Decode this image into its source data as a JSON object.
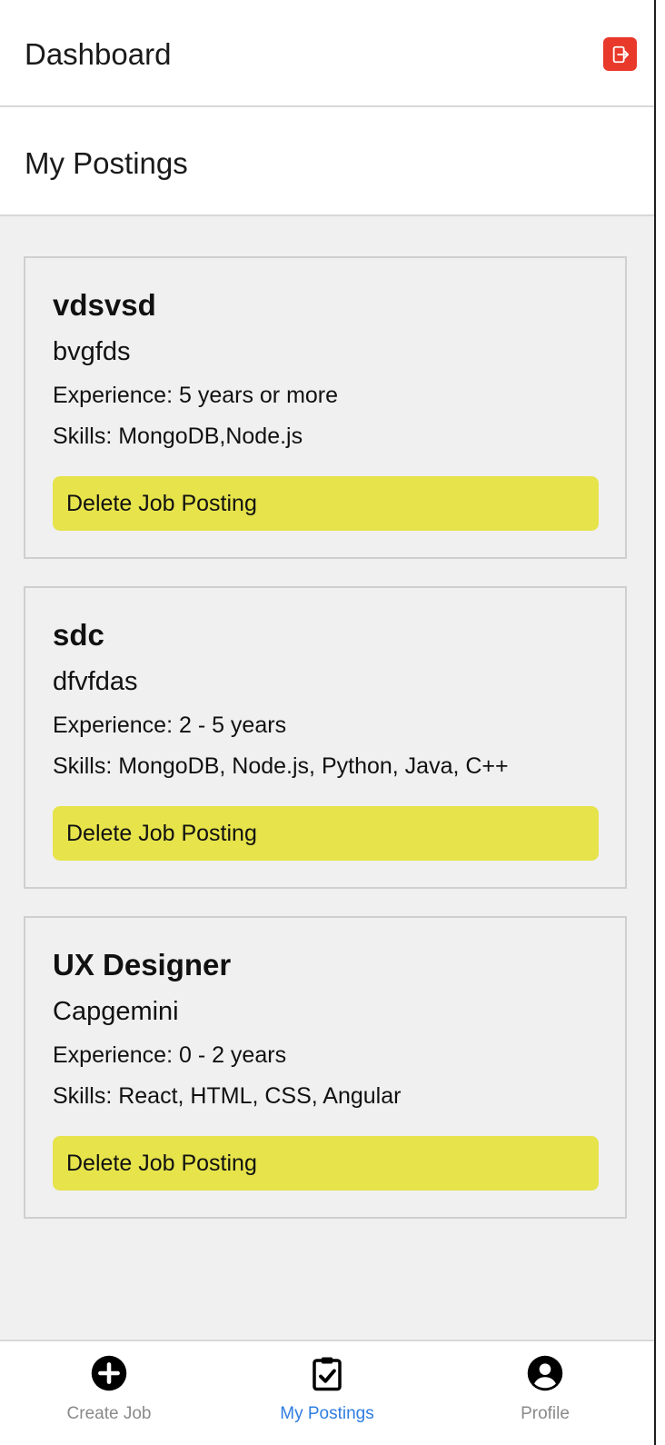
{
  "header": {
    "title": "Dashboard",
    "logout_icon": "logout-icon",
    "logout_color": "#e8392a"
  },
  "subheader": {
    "title": "My Postings"
  },
  "postings": [
    {
      "title": "vdsvsd",
      "company": "bvgfds",
      "experience": "Experience: 5 years or more",
      "skills": "Skills: MongoDB,Node.js",
      "delete_label": "Delete Job Posting"
    },
    {
      "title": "sdc",
      "company": "dfvfdas",
      "experience": "Experience: 2 - 5 years",
      "skills": "Skills: MongoDB, Node.js, Python, Java, C++",
      "delete_label": "Delete Job Posting"
    },
    {
      "title": "UX Designer",
      "company": "Capgemini",
      "experience": "Experience: 0 - 2 years",
      "skills": "Skills: React, HTML, CSS, Angular",
      "delete_label": "Delete Job Posting"
    }
  ],
  "tabs": [
    {
      "label": "Create Job",
      "icon": "plus-circle-icon",
      "active": false
    },
    {
      "label": "My Postings",
      "icon": "clipboard-check-icon",
      "active": true
    },
    {
      "label": "Profile",
      "icon": "user-circle-icon",
      "active": false
    }
  ],
  "colors": {
    "delete_button": "#e6e34b",
    "active_tab": "#2f7de1",
    "inactive_tab": "#8a8a8a",
    "background": "#f0f0f0"
  }
}
